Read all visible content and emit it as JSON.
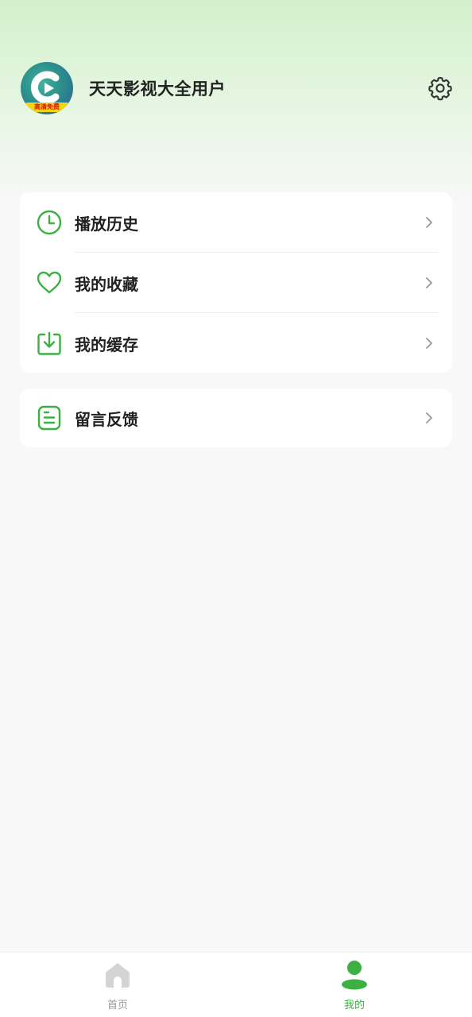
{
  "user": {
    "name": "天天影视大全用户",
    "avatar_banner": "高清免费"
  },
  "menu_primary": [
    {
      "label": "播放历史",
      "icon": "clock-icon"
    },
    {
      "label": "我的收藏",
      "icon": "heart-icon"
    },
    {
      "label": "我的缓存",
      "icon": "download-icon"
    }
  ],
  "menu_secondary": [
    {
      "label": "留言反馈",
      "icon": "feedback-icon"
    }
  ],
  "tabbar": {
    "home_label": "首页",
    "mine_label": "我的",
    "active": "mine"
  },
  "colors": {
    "accent": "#3cb043",
    "text": "#222222",
    "inactive": "#9a9a9a"
  }
}
